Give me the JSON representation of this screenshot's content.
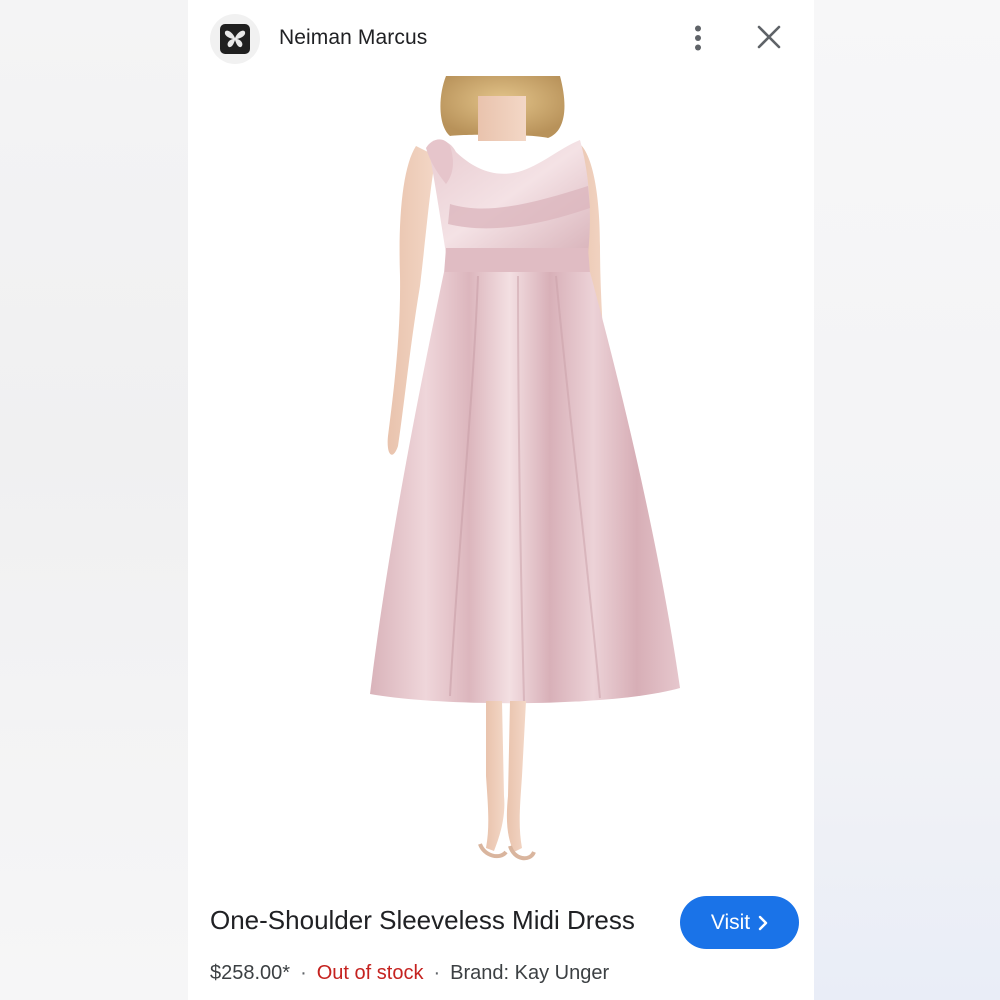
{
  "header": {
    "brand_name": "Neiman Marcus",
    "logo_icon": "butterfly-icon",
    "more_icon": "more-vert-icon",
    "close_icon": "close-icon"
  },
  "product": {
    "image_icon": "product-photo",
    "title": "One-Shoulder Sleeveless Midi Dress",
    "price": "$258.00*",
    "separator": "·",
    "stock_status": "Out of stock",
    "brand": "Brand: Kay Unger"
  },
  "visit_button": {
    "label": "Visit",
    "icon": "chevron-right-icon"
  },
  "colors": {
    "accent": "#1a73e8",
    "stock_status": "#c5221f",
    "dress": "#e3c2c8",
    "text": "#202124"
  }
}
